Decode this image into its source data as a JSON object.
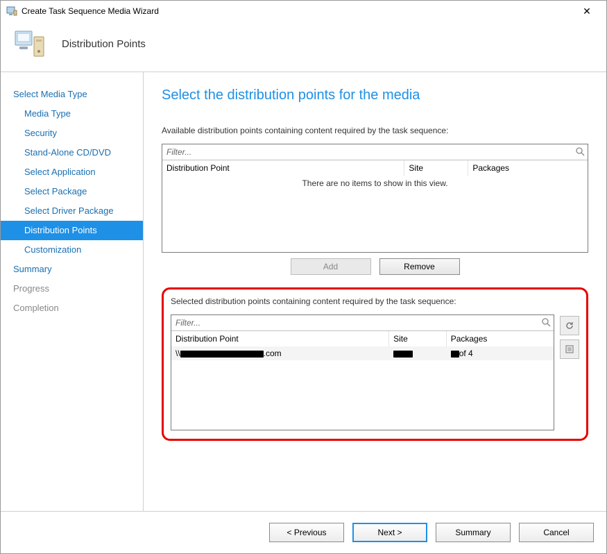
{
  "window": {
    "title": "Create Task Sequence Media Wizard"
  },
  "header": {
    "title": "Distribution Points"
  },
  "sidebar": {
    "items": [
      {
        "label": "Select Media Type",
        "indent": 0,
        "style": "link"
      },
      {
        "label": "Media Type",
        "indent": 1,
        "style": "link"
      },
      {
        "label": "Security",
        "indent": 1,
        "style": "link"
      },
      {
        "label": "Stand-Alone CD/DVD",
        "indent": 1,
        "style": "link"
      },
      {
        "label": "Select Application",
        "indent": 1,
        "style": "link"
      },
      {
        "label": "Select Package",
        "indent": 1,
        "style": "link"
      },
      {
        "label": "Select Driver Package",
        "indent": 1,
        "style": "link"
      },
      {
        "label": "Distribution Points",
        "indent": 1,
        "style": "active"
      },
      {
        "label": "Customization",
        "indent": 1,
        "style": "link"
      },
      {
        "label": "Summary",
        "indent": 0,
        "style": "link"
      },
      {
        "label": "Progress",
        "indent": 0,
        "style": "muted"
      },
      {
        "label": "Completion",
        "indent": 0,
        "style": "muted"
      }
    ]
  },
  "main": {
    "page_title": "Select the distribution points for the media",
    "available": {
      "label": "Available distribution points containing content required by the task sequence:",
      "filter_placeholder": "Filter...",
      "columns": {
        "dp": "Distribution Point",
        "site": "Site",
        "packages": "Packages"
      },
      "empty": "There are no items to show in this view."
    },
    "buttons": {
      "add": "Add",
      "remove": "Remove"
    },
    "selected": {
      "label": "Selected distribution points containing content required by the task sequence:",
      "filter_placeholder": "Filter...",
      "columns": {
        "dp": "Distribution Point",
        "site": "Site",
        "packages": "Packages"
      },
      "row": {
        "dp_prefix": "\\\\",
        "dp_suffix": ".com",
        "packages_suffix": "of 4"
      }
    }
  },
  "footer": {
    "previous": "< Previous",
    "next": "Next >",
    "summary": "Summary",
    "cancel": "Cancel"
  }
}
